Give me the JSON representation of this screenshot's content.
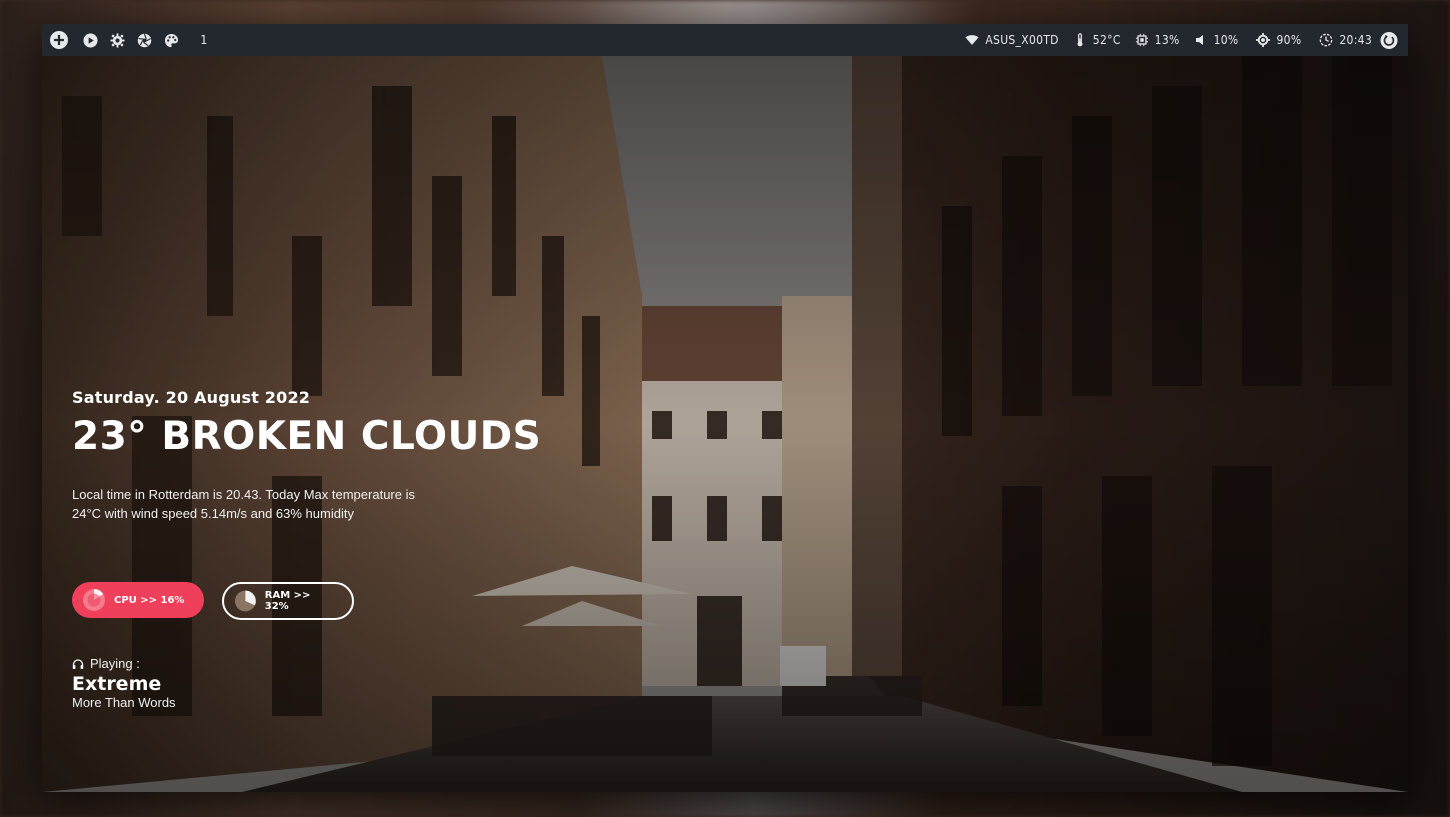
{
  "topbar": {
    "left_icons": [
      "add-icon",
      "play-icon",
      "settings-icon",
      "aperture-icon",
      "palette-icon"
    ],
    "workspace": "1",
    "wifi": {
      "icon": "wifi-icon",
      "label": "ASUS_X00TD"
    },
    "temperature": {
      "icon": "thermometer-icon",
      "label": "52°C"
    },
    "cpu": {
      "icon": "cpu-icon",
      "label": "13%"
    },
    "volume": {
      "icon": "volume-icon",
      "label": "10%"
    },
    "brightness": {
      "icon": "brightness-icon",
      "label": "90%"
    },
    "clock": {
      "icon": "clock-icon",
      "label": "20:43"
    },
    "power_icon": "power-icon"
  },
  "widget": {
    "date": "Saturday. 20 August 2022",
    "weather_headline": "23° BROKEN CLOUDS",
    "description": "Local time in Rotterdam  is 20.43. Today Max temperature is 24°C with wind speed 5.14m/s and 63% humidity",
    "cpu": {
      "label": "CPU >> 16%",
      "percent": 16,
      "color": "#ef3f5b"
    },
    "ram": {
      "label": "RAM >> 32%",
      "percent": 32
    },
    "now_playing": {
      "label": "Playing :",
      "icon": "headphones-icon",
      "title": "Extreme",
      "artist": "More Than Words"
    }
  },
  "colors": {
    "topbar_bg": "#23272e",
    "topbar_text": "#d8dce4",
    "accent": "#ef3f5b"
  }
}
